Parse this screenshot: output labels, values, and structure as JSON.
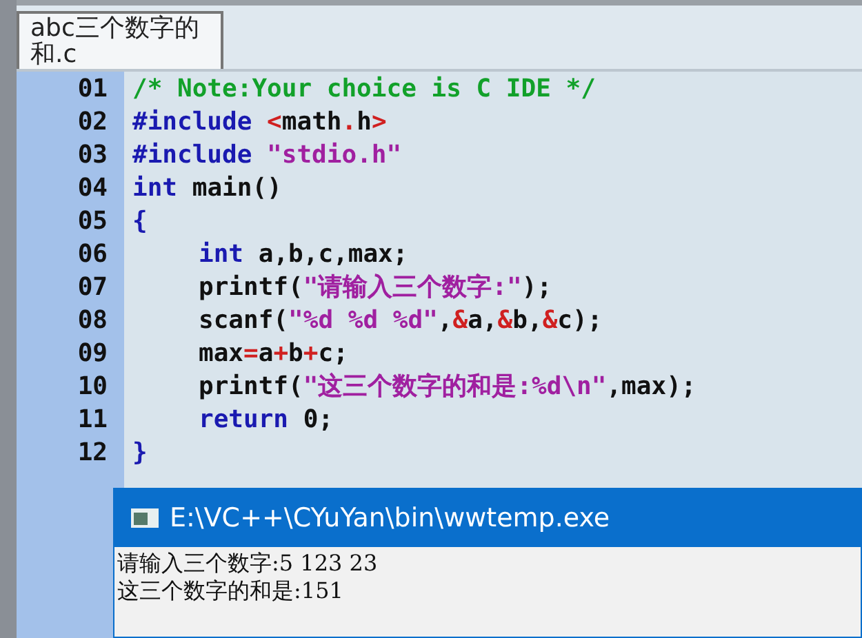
{
  "tab": {
    "label": "abc三个数字的和.c",
    "selected": true
  },
  "code_lines": [
    {
      "number": "01",
      "indented": false,
      "tokens": [
        {
          "kind": "comment",
          "text": "/* Note:Your choice is C IDE */"
        }
      ]
    },
    {
      "number": "02",
      "indented": false,
      "tokens": [
        {
          "kind": "preproc",
          "text": "#include "
        },
        {
          "kind": "operator",
          "text": "<"
        },
        {
          "kind": "plain",
          "text": "math"
        },
        {
          "kind": "operator",
          "text": "."
        },
        {
          "kind": "plain",
          "text": "h"
        },
        {
          "kind": "operator",
          "text": ">"
        }
      ]
    },
    {
      "number": "03",
      "indented": false,
      "tokens": [
        {
          "kind": "preproc",
          "text": "#include "
        },
        {
          "kind": "string",
          "text": "\"stdio.h\""
        }
      ]
    },
    {
      "number": "04",
      "indented": false,
      "tokens": [
        {
          "kind": "keyword",
          "text": "int"
        },
        {
          "kind": "plain",
          "text": " main()"
        }
      ]
    },
    {
      "number": "05",
      "indented": false,
      "tokens": [
        {
          "kind": "keyword",
          "text": "{"
        }
      ]
    },
    {
      "number": "06",
      "indented": true,
      "tokens": [
        {
          "kind": "keyword",
          "text": "int"
        },
        {
          "kind": "plain",
          "text": " a,b,c,max;"
        }
      ]
    },
    {
      "number": "07",
      "indented": true,
      "tokens": [
        {
          "kind": "plain",
          "text": "printf("
        },
        {
          "kind": "string",
          "text": "\"请输入三个数字:\""
        },
        {
          "kind": "plain",
          "text": ");"
        }
      ]
    },
    {
      "number": "08",
      "indented": true,
      "tokens": [
        {
          "kind": "plain",
          "text": "scanf("
        },
        {
          "kind": "string",
          "text": "\"%d %d %d\""
        },
        {
          "kind": "plain",
          "text": ","
        },
        {
          "kind": "operator",
          "text": "&"
        },
        {
          "kind": "plain",
          "text": "a,"
        },
        {
          "kind": "operator",
          "text": "&"
        },
        {
          "kind": "plain",
          "text": "b,"
        },
        {
          "kind": "operator",
          "text": "&"
        },
        {
          "kind": "plain",
          "text": "c);"
        }
      ]
    },
    {
      "number": "09",
      "indented": true,
      "tokens": [
        {
          "kind": "plain",
          "text": "max"
        },
        {
          "kind": "operator",
          "text": "="
        },
        {
          "kind": "plain",
          "text": "a"
        },
        {
          "kind": "operator",
          "text": "+"
        },
        {
          "kind": "plain",
          "text": "b"
        },
        {
          "kind": "operator",
          "text": "+"
        },
        {
          "kind": "plain",
          "text": "c;"
        }
      ]
    },
    {
      "number": "10",
      "indented": true,
      "tokens": [
        {
          "kind": "plain",
          "text": "printf("
        },
        {
          "kind": "string",
          "text": "\"这三个数字的和是:%d\\n\""
        },
        {
          "kind": "plain",
          "text": ",max);"
        }
      ]
    },
    {
      "number": "11",
      "indented": true,
      "tokens": [
        {
          "kind": "keyword",
          "text": "return"
        },
        {
          "kind": "plain",
          "text": " 0;"
        }
      ]
    },
    {
      "number": "12",
      "indented": false,
      "tokens": [
        {
          "kind": "keyword",
          "text": "}"
        }
      ]
    }
  ],
  "console": {
    "title": "E:\\VC++\\CYuYan\\bin\\wwtemp.exe",
    "lines": [
      "请输入三个数字:5 123 23",
      "这三个数字的和是:151"
    ]
  }
}
